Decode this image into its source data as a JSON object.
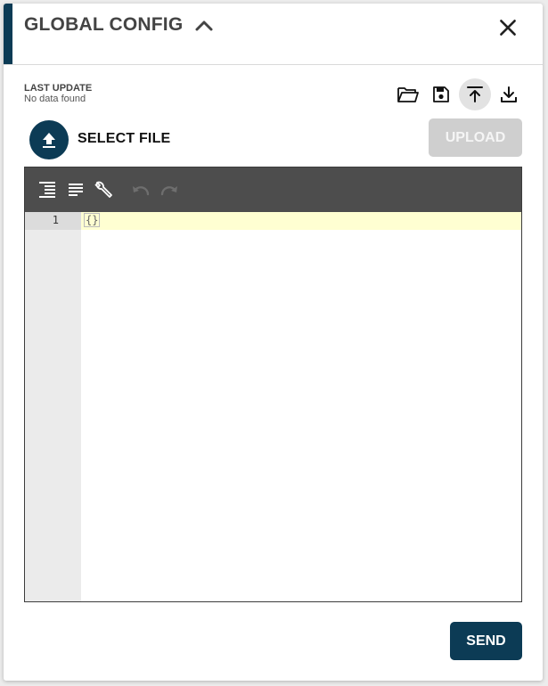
{
  "header": {
    "title": "GLOBAL CONFIG",
    "collapse_icon": "chevron-up-icon",
    "close_icon": "close-icon"
  },
  "last_update": {
    "label": "LAST UPDATE",
    "value": "No data found"
  },
  "toolbar": {
    "icons": [
      "folder-open-icon",
      "save-icon",
      "upload-icon",
      "download-icon"
    ],
    "active_icon": "upload-icon"
  },
  "file": {
    "select_label": "SELECT FILE",
    "upload_label": "UPLOAD"
  },
  "editor": {
    "toolbar_icons": [
      "format-icon",
      "compact-icon",
      "repair-icon",
      "undo-icon",
      "redo-icon"
    ],
    "line_number": "1",
    "content": "{}"
  },
  "actions": {
    "send_label": "SEND"
  },
  "colors": {
    "primary": "#0c3b55",
    "disabled": "#cfcfcf",
    "editor_toolbar": "#4d4d4d",
    "active_line": "#ffffd2"
  }
}
